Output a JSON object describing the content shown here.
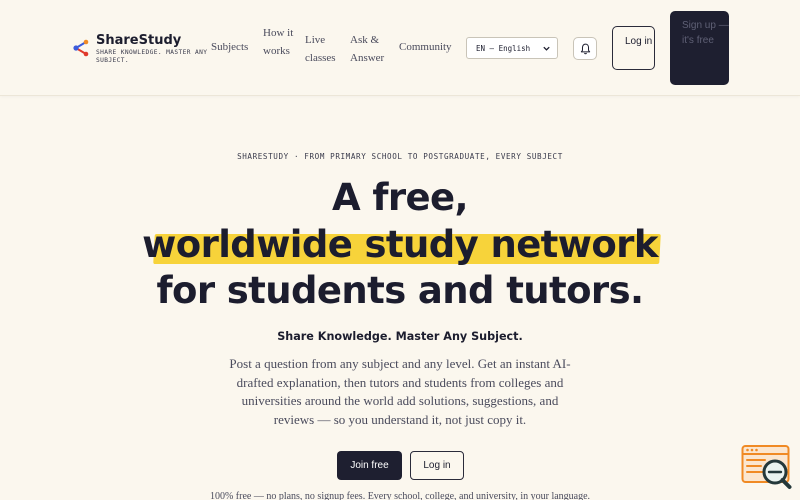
{
  "header": {
    "brand_name": "ShareStudy",
    "brand_tagline": "SHARE KNOWLEDGE. MASTER ANY SUBJECT.",
    "nav": {
      "subjects": "Subjects",
      "how_it_works": "How it works",
      "live_classes": "Live classes",
      "ask_answer": "Ask & Answer",
      "community": "Community"
    },
    "language_selected": "EN — English",
    "login_label": "Log in",
    "signup_label": "Sign up — it's free"
  },
  "hero": {
    "eyebrow": "SHARESTUDY · FROM PRIMARY SCHOOL TO POSTGRADUATE, EVERY SUBJECT",
    "headline_1": "A free,",
    "headline_2": "worldwide study network",
    "headline_3": "for students and tutors.",
    "subhead": "Share Knowledge. Master Any Subject.",
    "description": "Post a question from any subject and any level. Get an instant AI-drafted explanation, then tutors and students from colleges and universities around the world add solutions, suggestions, and reviews — so you understand it, not just copy it.",
    "join_label": "Join free",
    "login_label": "Log in",
    "footnote": "100% free — no plans, no signup fees. Every school, college, and university, in your language."
  },
  "colors": {
    "background": "#fbf7ee",
    "ink": "#1c1d2e",
    "highlight": "#f7d33a",
    "accent_orange": "#f08a24",
    "logo_blue": "#3b5bdb",
    "logo_red": "#e0392b"
  },
  "icons": {
    "brand": "share-nodes-icon",
    "bell": "bell-icon",
    "select": "chevron-down-icon",
    "helper": "search-code-icon"
  }
}
